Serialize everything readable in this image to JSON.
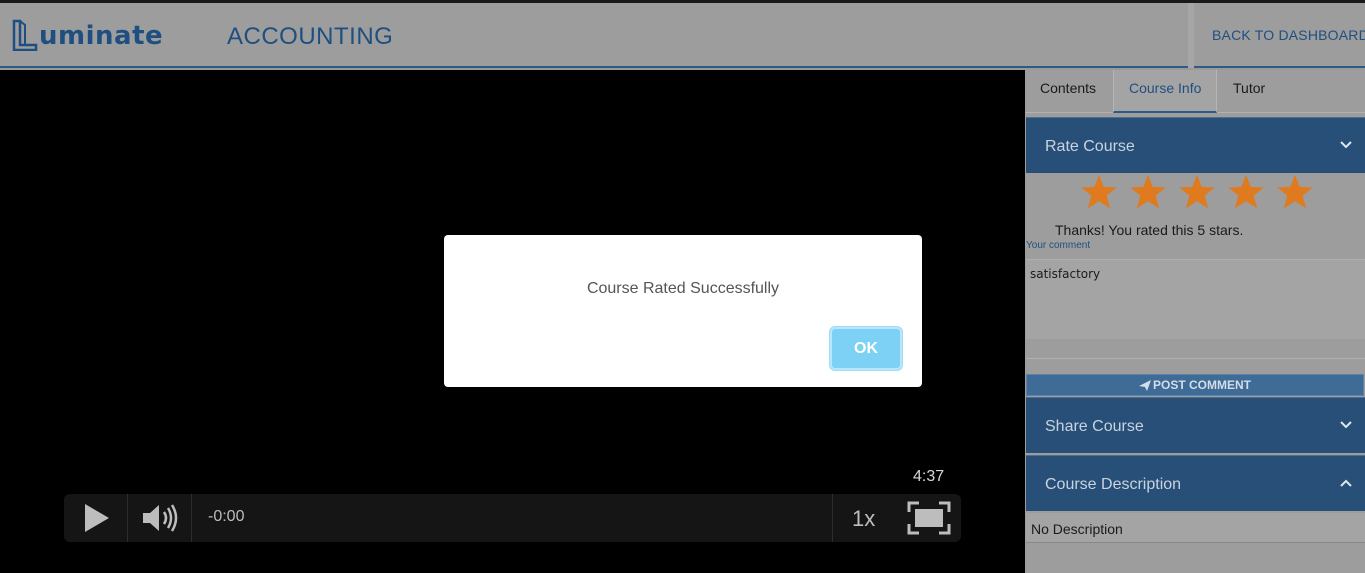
{
  "header": {
    "logo_text": "uminate",
    "course_title": "ACCOUNTING",
    "back_label": "BACK TO DASHBOARD"
  },
  "player": {
    "duration": "4:37",
    "time_remaining": "-0:00",
    "speed": "1x",
    "icons": [
      "play-icon",
      "volume-icon",
      "fullscreen-icon"
    ]
  },
  "modal": {
    "message": "Course Rated Successfully",
    "ok_label": "OK"
  },
  "sidebar": {
    "tabs": [
      {
        "label": "Contents",
        "active": false
      },
      {
        "label": "Course Info",
        "active": true
      },
      {
        "label": "Tutor",
        "active": false
      }
    ],
    "rate": {
      "header": "Rate Course",
      "rating": 5,
      "max_rating": 5,
      "thanks": "Thanks! You rated this 5 stars.",
      "comment_label": "Your comment",
      "comment_value": "satisfactory",
      "post_label": "POST COMMENT"
    },
    "share": {
      "header": "Share Course"
    },
    "description": {
      "header": "Course Description",
      "text": "No Description"
    }
  },
  "colors": {
    "brand": "#1f4f80",
    "accordion": "#274f78",
    "star": "#e07a1f",
    "ok_button": "#7cd1f5"
  }
}
